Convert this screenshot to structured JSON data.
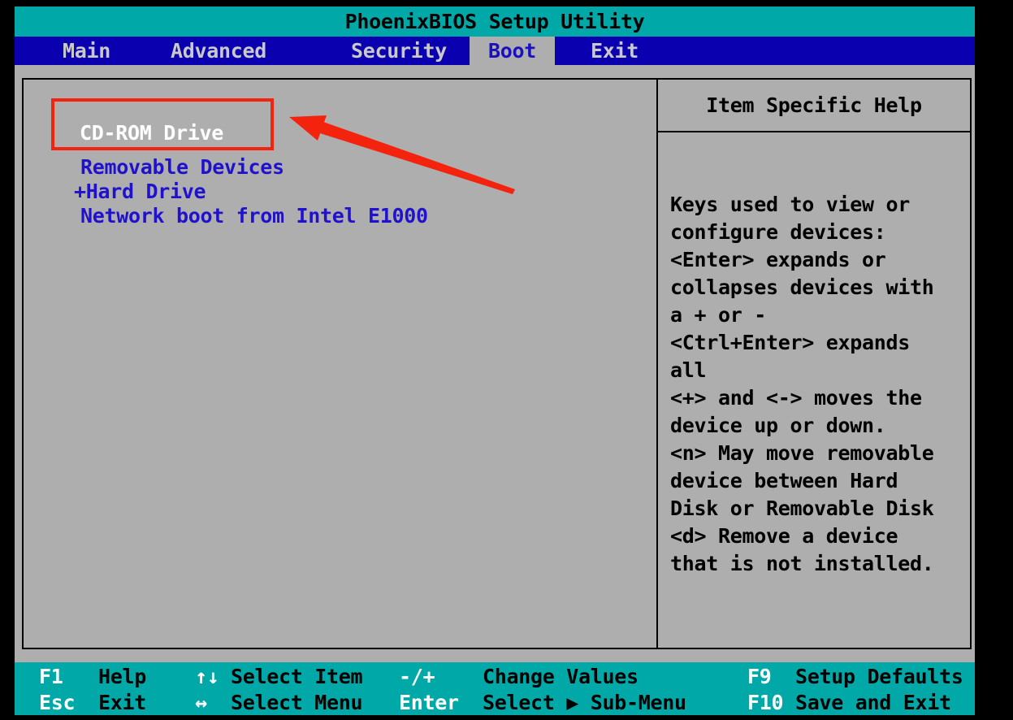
{
  "window": {
    "title": "PhoenixBIOS Setup Utility"
  },
  "menu_bar": {
    "items": [
      "Main",
      "Advanced",
      "Security",
      "Boot",
      "Exit"
    ],
    "selected": "Boot"
  },
  "boot_menu": {
    "items": [
      {
        "label": "CD-ROM Drive",
        "selected": true
      },
      {
        "label": "Removable Devices",
        "selected": false
      },
      {
        "label": "+Hard Drive",
        "selected": false
      },
      {
        "label": "Network boot from Intel E1000",
        "selected": false
      }
    ]
  },
  "help_panel": {
    "title": "Item Specific Help",
    "lines": [
      "Keys used to view or",
      "configure devices:",
      "<Enter> expands or",
      "collapses devices with",
      "a + or -",
      "<Ctrl+Enter> expands",
      "all",
      "<+> and <-> moves the",
      "device up or down.",
      "<n> May move removable",
      "device between Hard",
      "Disk or Removable Disk",
      "<d> Remove a device",
      "that is not installed."
    ]
  },
  "footer": {
    "row1": [
      {
        "key": "F1",
        "action": "Help"
      },
      {
        "key": "↑↓",
        "action": "Select Item"
      },
      {
        "key": "-/+",
        "action": "Change Values"
      },
      {
        "key": "F9",
        "action": "Setup Defaults"
      }
    ],
    "row2": [
      {
        "key": "Esc",
        "action": "Exit"
      },
      {
        "key": "↔",
        "action": "Select Menu"
      },
      {
        "key": "Enter",
        "action": "Select ▶ Sub-Menu"
      },
      {
        "key": "F10",
        "action": "Save and Exit"
      }
    ]
  },
  "annotation": {
    "highlighted_item": "CD-ROM Drive",
    "shape": "box-and-arrow",
    "color": "#f3230e"
  },
  "colors": {
    "title_bar_teal": "#00a8a8",
    "menu_bar_blue": "#0a00b0",
    "content_gray": "#aeaeae",
    "item_text_blue": "#2012cc",
    "selected_item_white": "#ffffff",
    "annotation_red": "#f3230e"
  }
}
